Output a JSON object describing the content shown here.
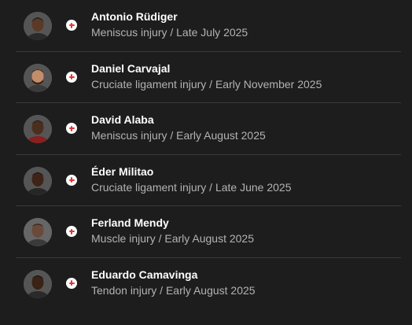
{
  "injury_list": {
    "players": [
      {
        "name": "Antonio Rüdiger",
        "detail": "Meniscus injury / Late July 2025",
        "avatar_icon": "player-photo-icon",
        "status_icon": "injury-cross-icon",
        "skin": "#5a3a26",
        "shirt": "#2a2a2a"
      },
      {
        "name": "Daniel Carvajal",
        "detail": "Cruciate ligament injury / Early November 2025",
        "avatar_icon": "player-photo-icon",
        "status_icon": "injury-cross-icon",
        "skin": "#c48e6a",
        "shirt": "#3a3a3a"
      },
      {
        "name": "David Alaba",
        "detail": "Meniscus injury / Early August 2025",
        "avatar_icon": "player-photo-icon",
        "status_icon": "injury-cross-icon",
        "skin": "#4a2e1e",
        "shirt": "#2b2b2b"
      },
      {
        "name": "Éder Militao",
        "detail": "Cruciate ligament injury / Late June 2025",
        "avatar_icon": "player-photo-icon",
        "status_icon": "injury-cross-icon",
        "skin": "#3d2416",
        "shirt": "#262626"
      },
      {
        "name": "Ferland Mendy",
        "detail": "Muscle injury / Early August 2025",
        "avatar_icon": "player-photo-icon",
        "status_icon": "injury-cross-icon",
        "skin": "#6a4a38",
        "shirt": "#3a3a3a"
      },
      {
        "name": "Eduardo Camavinga",
        "detail": "Tendon injury / Early August 2025",
        "avatar_icon": "player-photo-icon",
        "status_icon": "injury-cross-icon",
        "skin": "#3a2214",
        "shirt": "#2a2a2a"
      }
    ]
  },
  "colors": {
    "background": "#1d1d1d",
    "divider": "#3a3a3a",
    "name_text": "#ffffff",
    "detail_text": "#b3b3b3",
    "injury_red": "#e03535"
  }
}
